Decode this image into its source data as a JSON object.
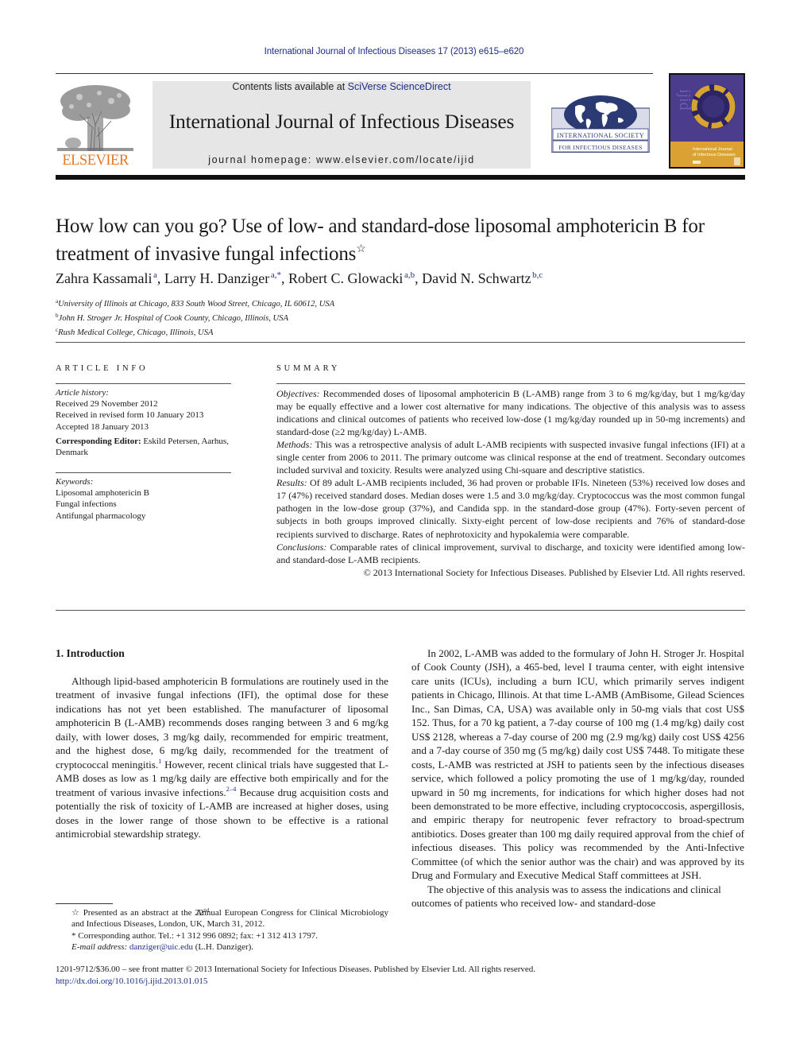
{
  "running_header": "International Journal of Infectious Diseases 17 (2013) e615–e620",
  "masthead": {
    "publisher_logo": "ELSEVIER",
    "contents_prefix": "Contents lists available at ",
    "contents_link": "SciVerse ScienceDirect",
    "journal_title": "International Journal of Infectious Diseases",
    "homepage_label": "journal homepage: www.elsevier.com/locate/ijid",
    "society_logo_line1": "International Society",
    "society_logo_line2": "for Infectious Diseases",
    "cover_title_line1": "International Journal",
    "cover_title_line2": "of Infectious Diseases",
    "cover_letters": "ijid",
    "colors": {
      "elsevier_orange": "#e87722",
      "link_blue": "#1f2e86",
      "isid_navy": "#2c3a73",
      "cover_purple": "#4b3d8c",
      "cover_gold": "#d9a232"
    }
  },
  "article": {
    "title": "How low can you go? Use of low- and standard-dose liposomal amphotericin B for treatment of invasive fungal infections",
    "title_note_mark": "☆",
    "authors": [
      {
        "name": "Zahra Kassamali",
        "sup": "a",
        "sep": ", "
      },
      {
        "name": "Larry H. Danziger",
        "sup": "a,*",
        "sep": ", "
      },
      {
        "name": "Robert C. Glowacki",
        "sup": "a,b",
        "sep": ", "
      },
      {
        "name": "David N. Schwartz",
        "sup": "b,c",
        "sep": ""
      }
    ],
    "affiliations": [
      {
        "mark": "a",
        "text": "University of Illinois at Chicago, 833 South Wood Street, Chicago, IL 60612, USA"
      },
      {
        "mark": "b",
        "text": "John H. Stroger Jr. Hospital of Cook County, Chicago, Illinois, USA"
      },
      {
        "mark": "c",
        "text": "Rush Medical College, Chicago, Illinois, USA"
      }
    ]
  },
  "article_info": {
    "heading": "ARTICLE INFO",
    "history_label": "Article history:",
    "history": [
      "Received 29 November 2012",
      "Received in revised form 10 January 2013",
      "Accepted 18 January 2013"
    ],
    "editor_label": "Corresponding Editor:",
    "editor_value": " Eskild Petersen, Aarhus, Denmark",
    "keywords_label": "Keywords:",
    "keywords": [
      "Liposomal amphotericin B",
      "Fungal infections",
      "Antifungal pharmacology"
    ]
  },
  "summary": {
    "heading": "SUMMARY",
    "sections": [
      {
        "label": "Objectives:",
        "text": "  Recommended doses of liposomal amphotericin B (L-AMB) range from 3 to 6 mg/kg/day, but 1 mg/kg/day may be equally effective and a lower cost alternative for many indications. The objective of this analysis was to assess indications and clinical outcomes of patients who received low-dose (1 mg/kg/day rounded up in 50-mg increments) and standard-dose (≥2 mg/kg/day) L-AMB."
      },
      {
        "label": "Methods:",
        "text": "  This was a retrospective analysis of adult L-AMB recipients with suspected invasive fungal infections (IFI) at a single center from 2006 to 2011. The primary outcome was clinical response at the end of treatment. Secondary outcomes included survival and toxicity. Results were analyzed using Chi-square and descriptive statistics."
      },
      {
        "label": "Results:",
        "text": "  Of 89 adult L-AMB recipients included, 36 had proven or probable IFIs. Nineteen (53%) received low doses and 17 (47%) received standard doses. Median doses were 1.5 and 3.0 mg/kg/day. Cryptococcus was the most common fungal pathogen in the low-dose group (37%), and Candida spp. in the standard-dose group (47%). Forty-seven percent of subjects in both groups improved clinically. Sixty-eight percent of low-dose recipients and 76% of standard-dose recipients survived to discharge. Rates of nephrotoxicity and hypokalemia were comparable."
      },
      {
        "label": "Conclusions:",
        "text": " Comparable rates of clinical improvement, survival to discharge, and toxicity were identified among low- and standard-dose L-AMB recipients."
      }
    ],
    "copyright": "© 2013 International Society for Infectious Diseases. Published by Elsevier Ltd. All rights reserved."
  },
  "body": {
    "section_heading": "1.  Introduction",
    "left_paragraph": {
      "p1": "Although lipid-based amphotericin B formulations are routinely used in the treatment of invasive fungal infections (IFI), the optimal dose for these indications has not yet been established. The manufacturer of liposomal amphotericin B (L-AMB) recommends doses ranging between 3 and 6 mg/kg daily, with lower doses, 3 mg/kg daily, recommended for empiric treatment, and the highest dose, 6 mg/kg daily, recommended for the treatment of cryptococcal meningitis.",
      "ref1": "1",
      "p2": " However, recent clinical trials have suggested that L-AMB doses as low as 1 mg/kg daily are effective both empirically and for the treatment of various invasive infections.",
      "ref2": "2–4",
      "p3": " Because drug acquisition costs and potentially the risk of toxicity of L-AMB are increased at higher doses, using doses in the lower range of those shown to be effective is a rational antimicrobial stewardship strategy."
    },
    "right_paragraphs": [
      "In 2002, L-AMB was added to the formulary of John H. Stroger Jr. Hospital of Cook County (JSH), a 465-bed, level I trauma center, with eight intensive care units (ICUs), including a burn ICU, which primarily serves indigent patients in Chicago, Illinois. At that time L-AMB (AmBisome, Gilead Sciences Inc., San Dimas, CA, USA) was available only in 50-mg vials that cost US$ 152. Thus, for a 70 kg patient, a 7-day course of 100 mg (1.4 mg/kg) daily cost US$ 2128, whereas a 7-day course of 200 mg (2.9 mg/kg) daily cost US$ 4256 and a 7-day course of 350 mg (5 mg/kg) daily cost US$ 7448. To mitigate these costs, L-AMB was restricted at JSH to patients seen by the infectious diseases service, which followed a policy promoting the use of 1 mg/kg/day, rounded upward in 50 mg increments, for indications for which higher doses had not been demonstrated to be more effective, including cryptococcosis, aspergillosis, and empiric therapy for neutropenic fever refractory to broad-spectrum antibiotics. Doses greater than 100 mg daily required approval from the chief of infectious diseases. This policy was recommended by the Anti-Infective Committee (of which the senior author was the chair) and was approved by its Drug and Formulary and Executive Medical Staff committees at JSH.",
      "The objective of this analysis was to assess the indications and clinical outcomes of patients who received low- and standard-dose"
    ]
  },
  "footnotes": {
    "presented_mark": "☆",
    "presented_a": " Presented as an abstract at the 22",
    "presented_sup": "nd",
    "presented_b": " Annual European Congress for Clinical Microbiology and Infectious Diseases, London, UK, March 31, 2012.",
    "corresponding": "* Corresponding author. Tel.: +1 312 996 0892; fax: +1 312 413 1797.",
    "email_label": "E-mail address: ",
    "email": "danziger@uic.edu",
    "email_suffix": " (L.H. Danziger)."
  },
  "bottom": {
    "issn_line": "1201-9712/$36.00 – see front matter © 2013 International Society for Infectious Diseases. Published by Elsevier Ltd. All rights reserved.",
    "doi": "http://dx.doi.org/10.1016/j.ijid.2013.01.015"
  }
}
